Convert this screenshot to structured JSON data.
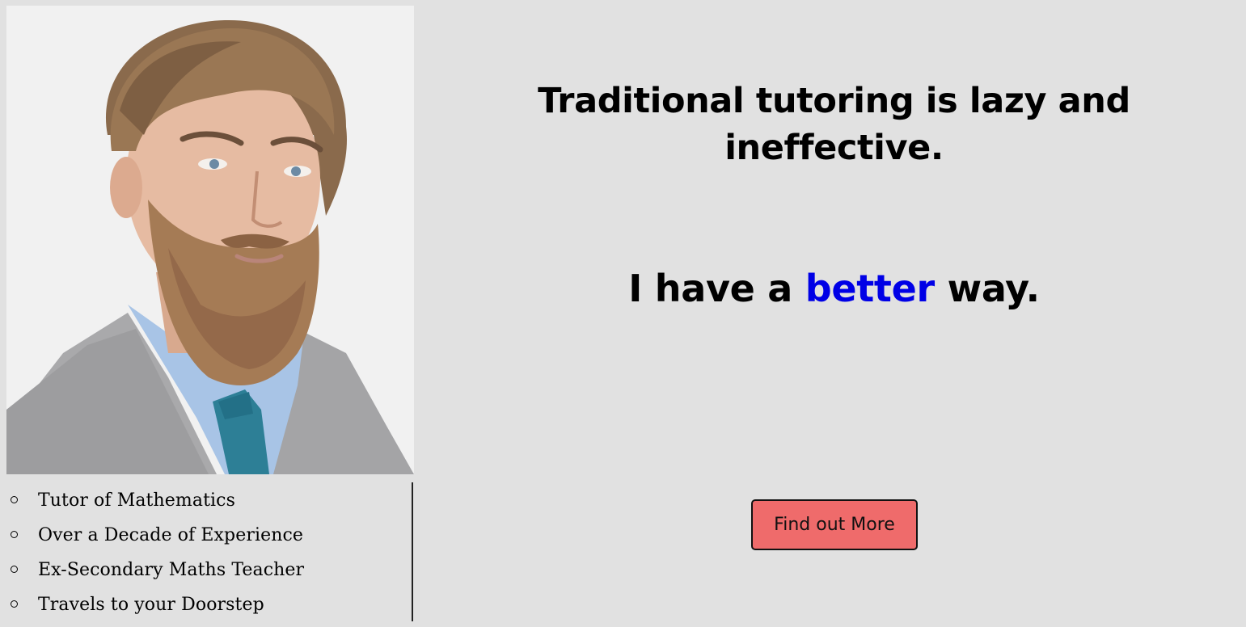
{
  "headline": "Traditional tutoring is lazy and ineffective.",
  "subline": {
    "before": "I have a ",
    "accent": "better",
    "after": " way."
  },
  "bio_items": [
    "Tutor of Mathematics",
    "Over a Decade of Experience",
    "Ex-Secondary Maths Teacher",
    "Travels to your Doorstep"
  ],
  "cta": {
    "label": "Find out More",
    "color": "#ef6b6b"
  },
  "colors": {
    "background": "#e1e1e1",
    "accent": "#0000e6"
  }
}
